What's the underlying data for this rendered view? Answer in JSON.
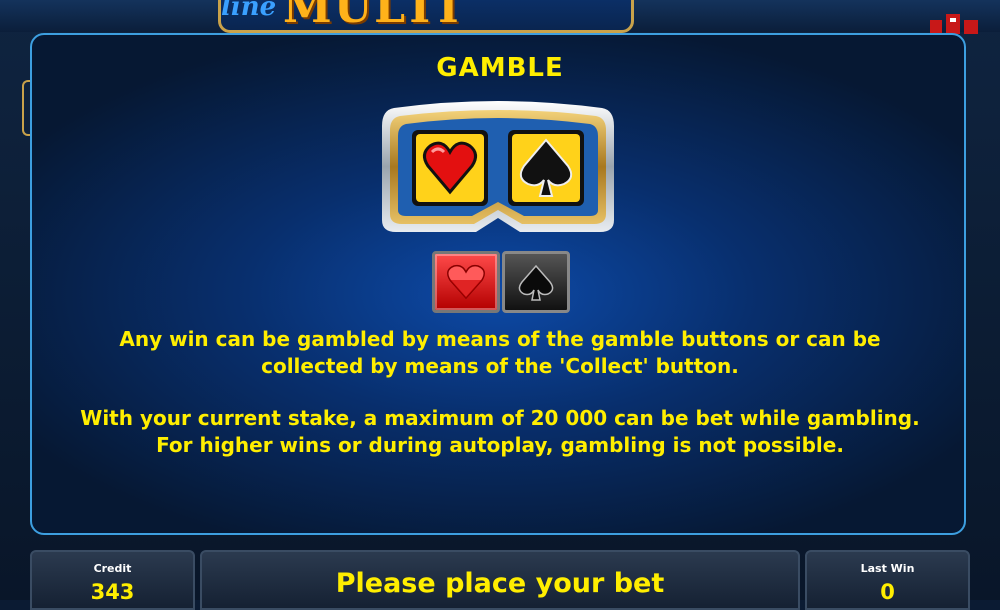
{
  "header": {
    "logo_script": "line",
    "logo_word": "MULTI"
  },
  "help_panel": {
    "title": "GAMBLE",
    "paragraph_1_line_1": "Any win can be gambled by means of the gamble buttons or can be",
    "paragraph_1_line_2": "collected by means of the 'Collect' button.",
    "paragraph_2_line_1": "With your current stake, a maximum of 20 000 can be bet while gambling.",
    "paragraph_2_line_2": "For higher wins or during autoplay, gambling is not possible.",
    "gamble_cards": [
      "heart-card-icon",
      "spade-card-icon"
    ],
    "gamble_buttons": [
      "red-heart-button",
      "black-spade-button"
    ]
  },
  "status_bar": {
    "credit_label": "Credit",
    "credit_value": "343",
    "message": "Please place your bet",
    "last_win_label": "Last Win",
    "last_win_value": "0"
  },
  "colors": {
    "text_yellow": "#ffee00",
    "panel_border": "#3d9fe0",
    "red_button": "#d10000",
    "black_button": "#222222"
  }
}
